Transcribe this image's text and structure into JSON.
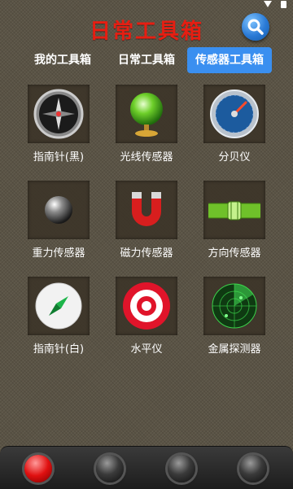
{
  "app": {
    "title": "日常工具箱"
  },
  "header": {
    "search_icon": "search-icon"
  },
  "tabs": [
    {
      "label": "我的工具箱",
      "active": false
    },
    {
      "label": "日常工具箱",
      "active": false
    },
    {
      "label": "传感器工具箱",
      "active": true
    }
  ],
  "tools": [
    {
      "label": "指南针(黑)",
      "icon": "compass-black-icon"
    },
    {
      "label": "光线传感器",
      "icon": "light-sensor-icon"
    },
    {
      "label": "分贝仪",
      "icon": "decibel-meter-icon"
    },
    {
      "label": "重力传感器",
      "icon": "gravity-ball-icon"
    },
    {
      "label": "磁力传感器",
      "icon": "magnet-icon"
    },
    {
      "label": "方向传感器",
      "icon": "spirit-level-icon"
    },
    {
      "label": "指南针(白)",
      "icon": "compass-white-icon"
    },
    {
      "label": "水平仪",
      "icon": "target-icon"
    },
    {
      "label": "金属探测器",
      "icon": "radar-icon"
    }
  ],
  "bottom_nav": {
    "selected_index": 0,
    "active_color": "#e01010"
  },
  "colors": {
    "title": "#e61e12",
    "accent": "#3a8ff0"
  }
}
